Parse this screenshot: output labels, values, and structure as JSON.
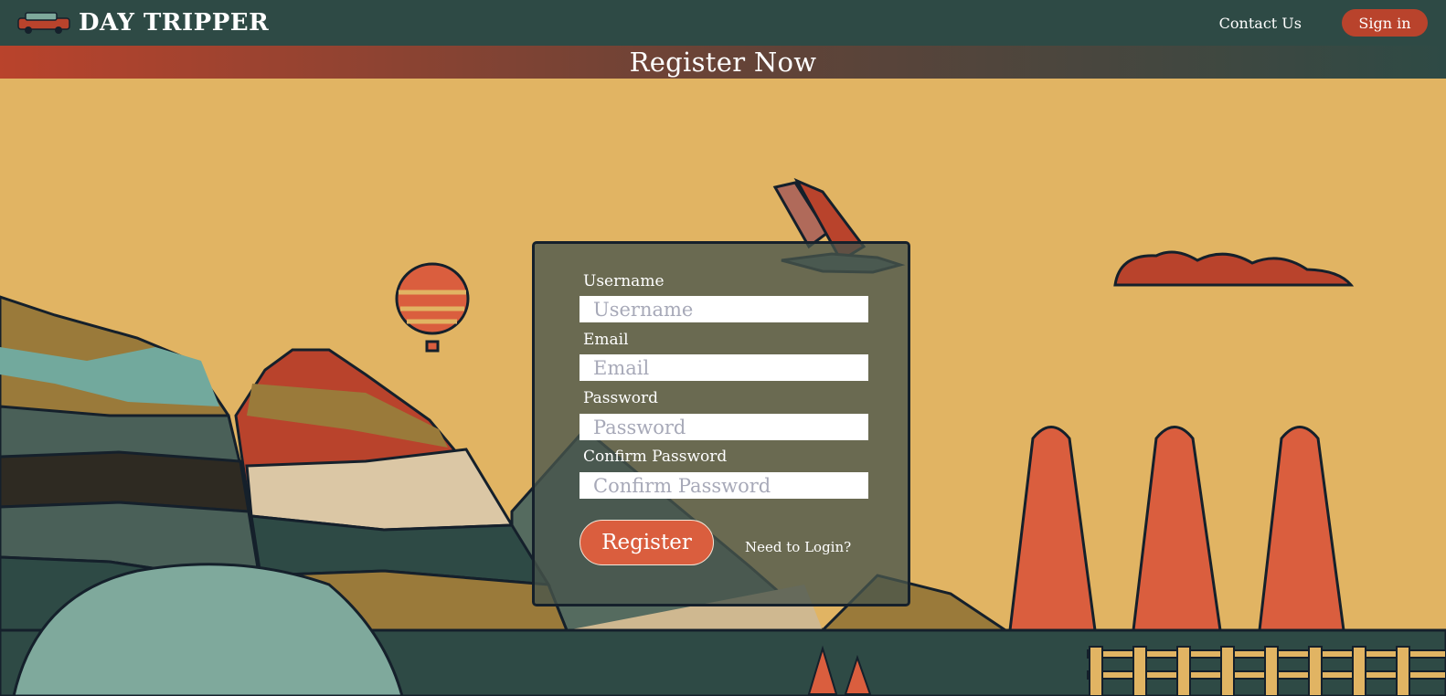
{
  "nav": {
    "brand": "DAY TRIPPER",
    "contact_label": "Contact Us",
    "signin_label": "Sign in"
  },
  "banner": {
    "title": "Register Now"
  },
  "form": {
    "fields": [
      {
        "label": "Username",
        "placeholder": "Username",
        "value": ""
      },
      {
        "label": "Email",
        "placeholder": "Email",
        "value": ""
      },
      {
        "label": "Password",
        "placeholder": "Password",
        "value": ""
      },
      {
        "label": "Confirm Password",
        "placeholder": "Confirm Password",
        "value": ""
      }
    ],
    "register_label": "Register",
    "login_link": "Need to Login?"
  },
  "colors": {
    "nav_bg": "#2e4a45",
    "accent": "#b9432c",
    "button": "#da5e3e",
    "sky": "#e1b463"
  }
}
